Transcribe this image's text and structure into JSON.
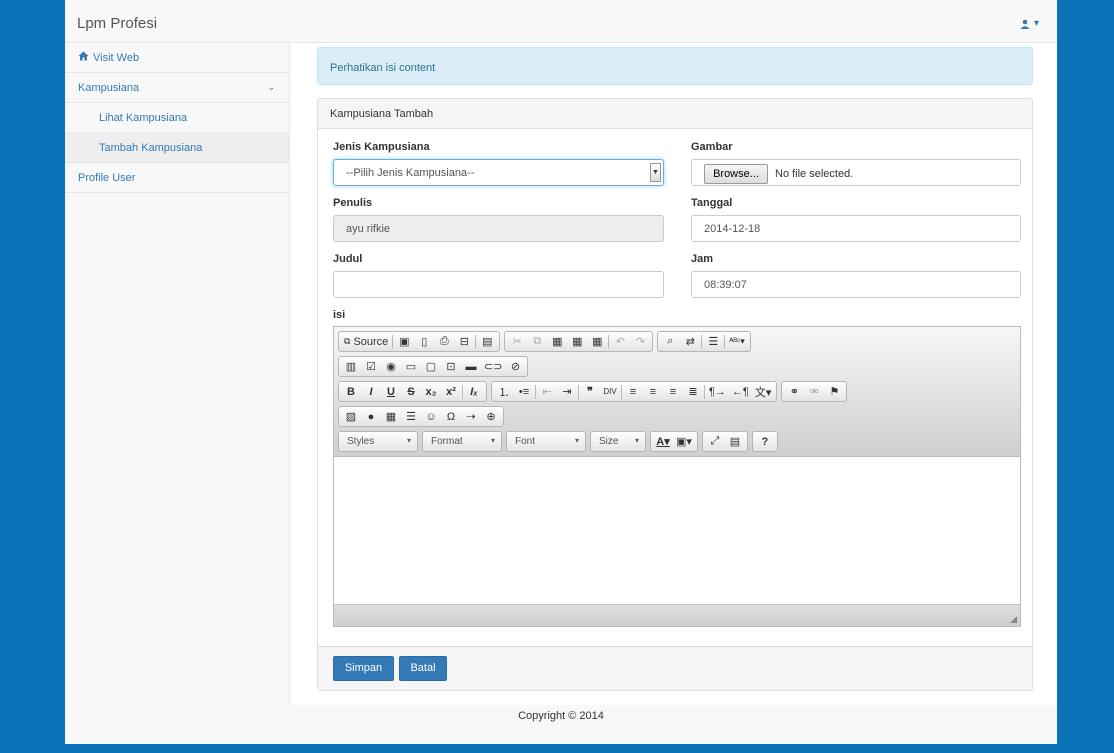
{
  "navbar": {
    "brand": "Lpm Profesi",
    "user_icon": "user-icon",
    "caret": "▾"
  },
  "sidebar": {
    "items": [
      {
        "label": "Visit Web",
        "icon": "home-icon"
      },
      {
        "label": "Kampusiana",
        "chevron": "⌄"
      },
      {
        "label": "Lihat Kampusiana"
      },
      {
        "label": "Tambah Kampusiana"
      },
      {
        "label": "Profile User"
      }
    ]
  },
  "alert": {
    "text": "Perhatikan isi content"
  },
  "panel": {
    "title": "Kampusiana Tambah",
    "jenis": {
      "label": "Jenis Kampusiana",
      "value": "--Pilih Jenis Kampusiana--"
    },
    "gambar": {
      "label": "Gambar",
      "button": "Browse...",
      "status": "No file selected."
    },
    "penulis": {
      "label": "Penulis",
      "value": "ayu rifkie"
    },
    "tanggal": {
      "label": "Tanggal",
      "value": "2014-12-18"
    },
    "judul": {
      "label": "Judul",
      "value": ""
    },
    "jam": {
      "label": "Jam",
      "value": "08:39:07"
    },
    "isi": {
      "label": "isi"
    }
  },
  "editor": {
    "source_label": "Source",
    "combos": [
      "Styles",
      "Format",
      "Font",
      "Size"
    ]
  },
  "actions": {
    "save": "Simpan",
    "cancel": "Batal"
  },
  "footer": {
    "copyright": "Copyright © 2014"
  },
  "colors": {
    "primary": "#337ab7",
    "background": "#0a72b6",
    "alert_bg": "#d9edf7"
  }
}
